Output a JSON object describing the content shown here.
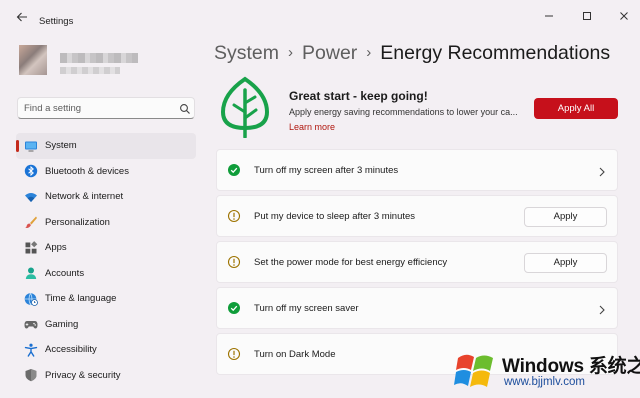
{
  "window": {
    "title": "Settings",
    "back_icon": "back-arrow-icon",
    "controls": [
      "minimize-icon",
      "maximize-icon",
      "close-icon"
    ]
  },
  "profile": {
    "avatar": "blurred-avatar",
    "name": "",
    "email": ""
  },
  "search": {
    "placeholder": "Find a setting",
    "icon": "search-icon"
  },
  "sidebar": {
    "items": [
      {
        "label": "System",
        "icon": "monitor-icon",
        "selected": true
      },
      {
        "label": "Bluetooth & devices",
        "icon": "bluetooth-icon",
        "selected": false
      },
      {
        "label": "Network & internet",
        "icon": "wifi-icon",
        "selected": false
      },
      {
        "label": "Personalization",
        "icon": "brush-icon",
        "selected": false
      },
      {
        "label": "Apps",
        "icon": "apps-icon",
        "selected": false
      },
      {
        "label": "Accounts",
        "icon": "person-icon",
        "selected": false
      },
      {
        "label": "Time & language",
        "icon": "globe-clock-icon",
        "selected": false
      },
      {
        "label": "Gaming",
        "icon": "gamepad-icon",
        "selected": false
      },
      {
        "label": "Accessibility",
        "icon": "accessibility-icon",
        "selected": false
      },
      {
        "label": "Privacy & security",
        "icon": "shield-icon",
        "selected": false
      }
    ]
  },
  "breadcrumb": {
    "items": [
      "System",
      "Power",
      "Energy Recommendations"
    ],
    "separator": "›"
  },
  "hero": {
    "icon": "leaf-icon",
    "title": "Great start - keep going!",
    "description": "Apply energy saving recommendations to lower your ca...",
    "link": "Learn more",
    "apply_all": "Apply All"
  },
  "recommendations": [
    {
      "label": "Turn off my screen after 3 minutes",
      "status": "done",
      "status_icon": "checkmark-circle-icon",
      "action": "chevron"
    },
    {
      "label": "Put my device to sleep after 3 minutes",
      "status": "pending",
      "status_icon": "info-circle-icon",
      "action": "apply",
      "action_label": "Apply"
    },
    {
      "label": "Set the power mode for best energy efficiency",
      "status": "pending",
      "status_icon": "info-circle-icon",
      "action": "apply",
      "action_label": "Apply"
    },
    {
      "label": "Turn off my screen saver",
      "status": "done",
      "status_icon": "checkmark-circle-icon",
      "action": "chevron"
    },
    {
      "label": "Turn on Dark Mode",
      "status": "pending",
      "status_icon": "info-circle-icon",
      "action": "none"
    }
  ],
  "watermark": {
    "brand": "Windows 系统之家",
    "url": "www.bjjmlv.com",
    "icon": "windows-logo-icon"
  },
  "colors": {
    "accent": "#c42b1c",
    "apply_all_bg": "#c6101b",
    "success": "#0f9d3a",
    "warning": "#9d7300",
    "leaf": "#1aa64b"
  }
}
